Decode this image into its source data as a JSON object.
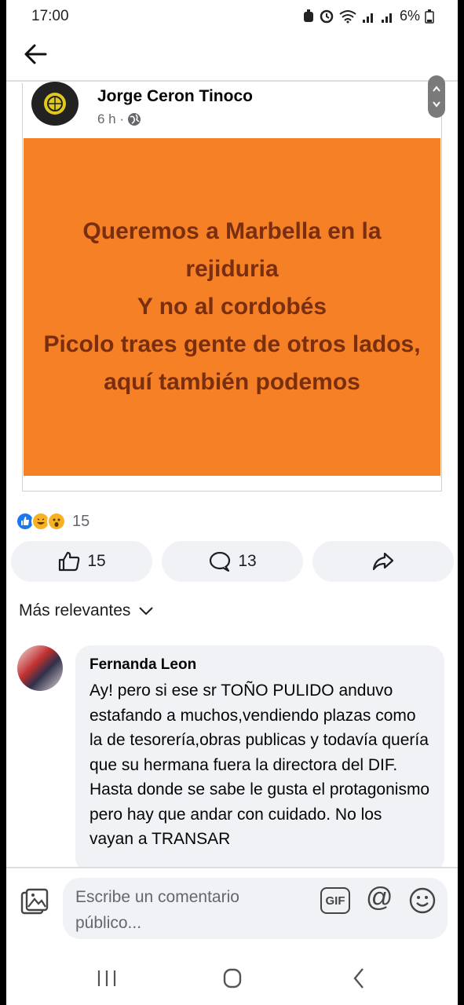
{
  "status_bar": {
    "time": "17:00",
    "battery": "6%",
    "icons": [
      "alarm-icon",
      "clock-icon",
      "wifi-icon",
      "signal-icon",
      "signal-icon",
      "battery-icon"
    ]
  },
  "post": {
    "author": "Jorge Ceron Tinoco",
    "time": "6 h ·",
    "privacy_icon": "globe-icon",
    "text": "Queremos a Marbella en la rejiduria\nY no al cordobés\nPicolo traes gente de otros lados, aquí también podemos",
    "background_color": "#f58025",
    "text_color": "#7a2e10"
  },
  "reactions": {
    "types": [
      "like-icon",
      "haha-icon",
      "wow-icon"
    ],
    "count": "15"
  },
  "actions": {
    "like_count": "15",
    "comment_count": "13"
  },
  "comments_sort": {
    "label": "Más relevantes"
  },
  "comment": {
    "author": "Fernanda Leon",
    "text": "Ay! pero si ese sr TOÑO PULIDO anduvo estafando a muchos,vendiendo plazas como la de tesorería,obras publicas y todavía quería que su hermana fuera la directora del DIF. Hasta donde se sabe le gusta el protagonismo pero hay que andar con cuidado. No los vayan a TRANSAR"
  },
  "composer": {
    "placeholder": "Escribe un comentario público...",
    "gif_label": "GIF",
    "at_label": "@"
  }
}
